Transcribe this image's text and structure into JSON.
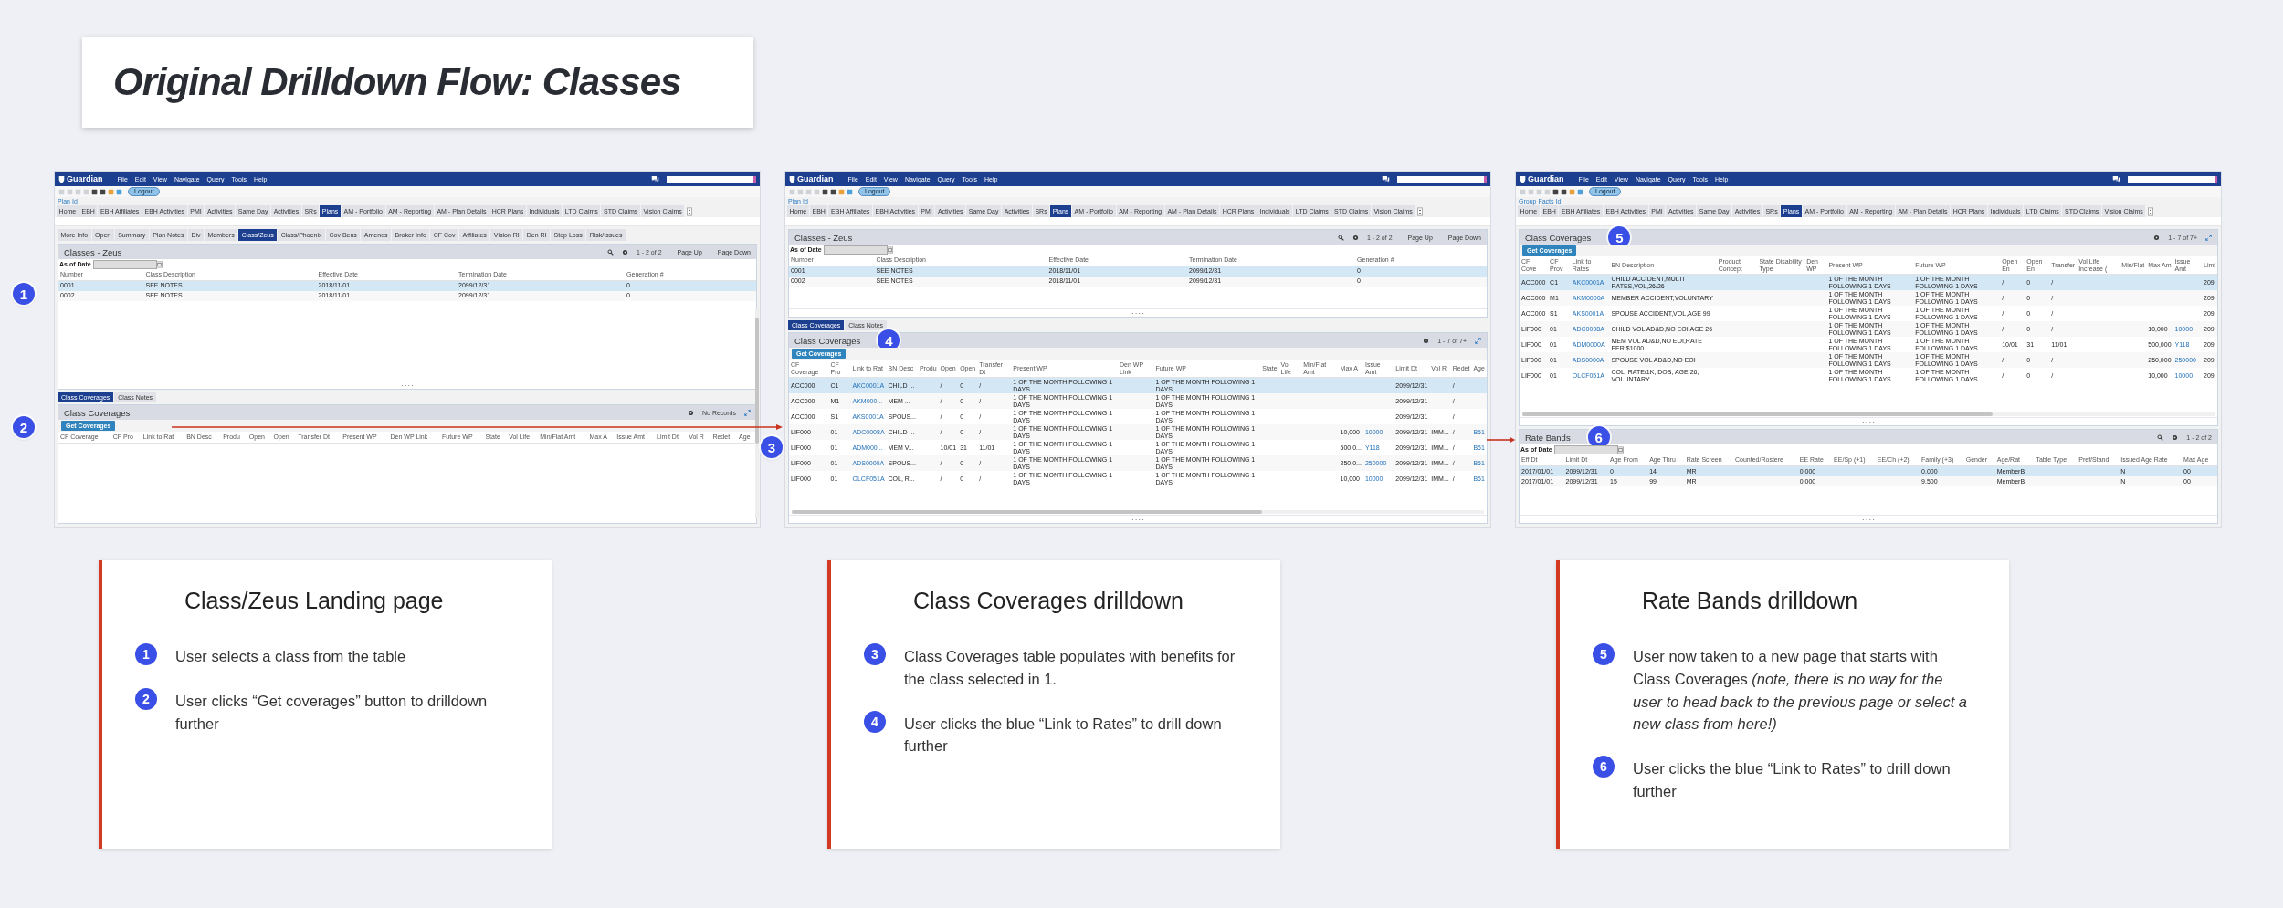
{
  "title": "Original Drilldown Flow: Classes",
  "screens": [
    {
      "app_bar": {
        "logo": "Guardian",
        "menu": [
          "File",
          "Edit",
          "View",
          "Navigate",
          "Query",
          "Tools",
          "Help"
        ]
      },
      "logout": "Logout",
      "id_label": "Plan Id",
      "vertical_scroll": true,
      "badges": [
        "1",
        "2"
      ],
      "main_tabs": [
        {
          "label": "Home",
          "selected": false
        },
        {
          "label": "EBH",
          "selected": false
        },
        {
          "label": "EBH Affiliates",
          "selected": false
        },
        {
          "label": "EBH Activities",
          "selected": false
        },
        {
          "label": "PMI",
          "selected": false
        },
        {
          "label": "Activities",
          "selected": false
        },
        {
          "label": "Same Day",
          "selected": false
        },
        {
          "label": "Activities",
          "selected": false
        },
        {
          "label": "SRs",
          "selected": false
        },
        {
          "label": "Plans",
          "selected": true
        },
        {
          "label": "AM - Portfolio",
          "selected": false
        },
        {
          "label": "AM - Reporting",
          "selected": false
        },
        {
          "label": "AM - Plan Details",
          "selected": false
        },
        {
          "label": "HCR Plans",
          "selected": false
        },
        {
          "label": "Individuals",
          "selected": false
        },
        {
          "label": "LTD Claims",
          "selected": false
        },
        {
          "label": "STD Claims",
          "selected": false
        },
        {
          "label": "Vision Claims",
          "selected": false
        }
      ],
      "sub_tabs": [
        {
          "label": "More Info",
          "selected": false
        },
        {
          "label": "Open",
          "selected": false
        },
        {
          "label": "Summary",
          "selected": false
        },
        {
          "label": "Plan Notes",
          "selected": false
        },
        {
          "label": "Div",
          "selected": false
        },
        {
          "label": "Members",
          "selected": false
        },
        {
          "label": "Class/Zeus",
          "selected": true
        },
        {
          "label": "Class/Phoenix",
          "selected": false
        },
        {
          "label": "Cov Bens",
          "selected": false
        },
        {
          "label": "Amends",
          "selected": false
        },
        {
          "label": "Broker Info",
          "selected": false
        },
        {
          "label": "CF Cov",
          "selected": false
        },
        {
          "label": "Affiliates",
          "selected": false
        },
        {
          "label": "Vision RI",
          "selected": false
        },
        {
          "label": "Den RI",
          "selected": false
        },
        {
          "label": "Stop Loss",
          "selected": false
        },
        {
          "label": "Risk/Issues",
          "selected": false
        }
      ],
      "panels": [
        {
          "title": "Classes - Zeus",
          "grip": true,
          "as_of_date": "As of Date",
          "tools": [
            {
              "kind": "search"
            },
            {
              "kind": "gear"
            },
            {
              "kind": "pager",
              "text": "1 - 2 of 2"
            },
            {
              "kind": "link",
              "text": "Page Up"
            },
            {
              "kind": "link",
              "text": "Page Down"
            }
          ],
          "columns": [
            "Number",
            "Class Description",
            "Effective Date",
            "Termination Date",
            "Generation #"
          ],
          "rows": [
            {
              "selected": true,
              "cells": [
                "0001",
                "SEE NOTES",
                "2018/11/01",
                "2099/12/31",
                "0"
              ]
            },
            {
              "selected": false,
              "cells": [
                "0002",
                "SEE NOTES",
                "2018/11/01",
                "2099/12/31",
                "0"
              ]
            }
          ]
        },
        {
          "tabs": [
            {
              "label": "Class Coverages",
              "selected": true
            },
            {
              "label": "Class Notes",
              "selected": false
            }
          ],
          "title": "Class Coverages",
          "button": "Get Coverages",
          "tools": [
            {
              "kind": "gear"
            },
            {
              "kind": "pager",
              "text": "No Records"
            },
            {
              "kind": "expand"
            }
          ],
          "columns": [
            "CF Coverage",
            "CF Pro",
            "Link to Rat",
            "BN Desc",
            "Produ",
            "Open",
            "Open",
            "Transfer Dt",
            "Present WP",
            "Den WP Link",
            "Future WP",
            "State",
            "Vol Life",
            "Min/Flat Amt",
            "Max A",
            "Issue Amt",
            "Limit Dt",
            "Vol R",
            "Redet",
            "Age"
          ]
        }
      ]
    },
    {
      "app_bar": {
        "logo": "Guardian",
        "menu": [
          "File",
          "Edit",
          "View",
          "Navigate",
          "Query",
          "Tools",
          "Help"
        ]
      },
      "logout": "Logout",
      "id_label": "Plan Id",
      "badges": [
        "3"
      ],
      "main_tabs": [
        {
          "label": "Home",
          "selected": false
        },
        {
          "label": "EBH",
          "selected": false
        },
        {
          "label": "EBH Affiliates",
          "selected": false
        },
        {
          "label": "EBH Activities",
          "selected": false
        },
        {
          "label": "PMI",
          "selected": false
        },
        {
          "label": "Activities",
          "selected": false
        },
        {
          "label": "Same Day",
          "selected": false
        },
        {
          "label": "Activities",
          "selected": false
        },
        {
          "label": "SRs",
          "selected": false
        },
        {
          "label": "Plans",
          "selected": true
        },
        {
          "label": "AM - Portfolio",
          "selected": false
        },
        {
          "label": "AM - Reporting",
          "selected": false
        },
        {
          "label": "AM - Plan Details",
          "selected": false
        },
        {
          "label": "HCR Plans",
          "selected": false
        },
        {
          "label": "Individuals",
          "selected": false
        },
        {
          "label": "LTD Claims",
          "selected": false
        },
        {
          "label": "STD Claims",
          "selected": false
        },
        {
          "label": "Vision Claims",
          "selected": false
        }
      ],
      "panels": [
        {
          "title": "Classes - Zeus",
          "grip": true,
          "as_of_date": "As of Date",
          "tools": [
            {
              "kind": "search"
            },
            {
              "kind": "gear"
            },
            {
              "kind": "pager",
              "text": "1 - 2 of 2"
            },
            {
              "kind": "link",
              "text": "Page Up"
            },
            {
              "kind": "link",
              "text": "Page Down"
            }
          ],
          "columns": [
            "Number",
            "Class Description",
            "Effective Date",
            "Termination Date",
            "Generation #"
          ],
          "rows": [
            {
              "selected": true,
              "cells": [
                "0001",
                "SEE NOTES",
                "2018/11/01",
                "2099/12/31",
                "0"
              ]
            },
            {
              "selected": false,
              "cells": [
                "0002",
                "SEE NOTES",
                "2018/11/01",
                "2099/12/31",
                "0"
              ]
            }
          ]
        },
        {
          "tabs": [
            {
              "label": "Class Coverages",
              "selected": true
            },
            {
              "label": "Class Notes",
              "selected": false
            }
          ],
          "title": "Class Coverages",
          "badge": "4",
          "button": "Get Coverages",
          "grip": true,
          "horizontal_scroll": true,
          "tools": [
            {
              "kind": "gear"
            },
            {
              "kind": "pager",
              "text": "1 - 7 of 7+"
            },
            {
              "kind": "expand"
            }
          ],
          "columns": [
            "CF Coverage",
            "CF Pro",
            "Link to Rat",
            "BN Desc",
            "Produ",
            "Open",
            "Open",
            "Transfer Dt",
            "Present WP",
            "Den WP Link",
            "Future WP",
            "State",
            "Vol Life",
            "Min/Flat Amt",
            "Max A",
            "Issue Amt",
            "Limit Dt",
            "Vol R",
            "Redet",
            "Age"
          ],
          "rows": [
            {
              "selected": true,
              "cells": [
                "ACC000",
                "C1",
                {
                  "kind": "link",
                  "text": "AKC0001A"
                },
                "CHILD ...",
                null,
                "/",
                "0",
                "/",
                "1 OF THE MONTH FOLLOWING 1 DAYS",
                null,
                "1 OF THE MONTH FOLLOWING 1 DAYS",
                null,
                null,
                null,
                null,
                null,
                "2099/12/31",
                null,
                "/",
                null
              ]
            },
            {
              "selected": false,
              "cells": [
                "ACC000",
                "M1",
                {
                  "kind": "link",
                  "text": "AKM000..."
                },
                "MEM ...",
                null,
                "/",
                "0",
                "/",
                "1 OF THE MONTH FOLLOWING 1 DAYS",
                null,
                "1 OF THE MONTH FOLLOWING 1 DAYS",
                null,
                null,
                null,
                null,
                null,
                "2099/12/31",
                null,
                "/",
                null
              ]
            },
            {
              "selected": false,
              "cells": [
                "ACC000",
                "S1",
                {
                  "kind": "link",
                  "text": "AKS0001A"
                },
                "SPOUS...",
                null,
                "/",
                "0",
                "/",
                "1 OF THE MONTH FOLLOWING 1 DAYS",
                null,
                "1 OF THE MONTH FOLLOWING 1 DAYS",
                null,
                null,
                null,
                null,
                null,
                "2099/12/31",
                null,
                "/",
                null
              ]
            },
            {
              "selected": false,
              "cells": [
                "LIF000",
                "01",
                {
                  "kind": "link",
                  "text": "ADC0008A"
                },
                "CHILD ...",
                null,
                "/",
                "0",
                "/",
                "1 OF THE MONTH FOLLOWING 1 DAYS",
                null,
                "1 OF THE MONTH FOLLOWING 1 DAYS",
                null,
                null,
                null,
                "10,000",
                {
                  "kind": "link",
                  "text": "10000"
                },
                "2099/12/31",
                "IMM...",
                "/",
                {
                  "kind": "link",
                  "text": "B51"
                }
              ]
            },
            {
              "selected": false,
              "cells": [
                "LIF000",
                "01",
                {
                  "kind": "link",
                  "text": "ADM000..."
                },
                "MEM V...",
                null,
                "10/01",
                "31",
                "11/01",
                "1 OF THE MONTH FOLLOWING 1 DAYS",
                null,
                "1 OF THE MONTH FOLLOWING 1 DAYS",
                null,
                null,
                null,
                "500,0...",
                {
                  "kind": "link",
                  "text": "Y118"
                },
                "2099/12/31",
                "IMM...",
                "/",
                {
                  "kind": "link",
                  "text": "B51"
                }
              ]
            },
            {
              "selected": false,
              "cells": [
                "LIF000",
                "01",
                {
                  "kind": "link",
                  "text": "ADS0000A"
                },
                "SPOUS...",
                null,
                "/",
                "0",
                "/",
                "1 OF THE MONTH FOLLOWING 1 DAYS",
                null,
                "1 OF THE MONTH FOLLOWING 1 DAYS",
                null,
                null,
                null,
                "250,0...",
                {
                  "kind": "link",
                  "text": "250000"
                },
                "2099/12/31",
                "IMM...",
                "/",
                {
                  "kind": "link",
                  "text": "B51"
                }
              ]
            },
            {
              "selected": false,
              "cells": [
                "LIF000",
                "01",
                {
                  "kind": "link",
                  "text": "OLCF051A"
                },
                "COL, R...",
                null,
                "/",
                "0",
                "/",
                "1 OF THE MONTH FOLLOWING 1 DAYS",
                null,
                "1 OF THE MONTH FOLLOWING 1 DAYS",
                null,
                null,
                null,
                "10,000",
                {
                  "kind": "link",
                  "text": "10000"
                },
                "2099/12/31",
                "IMM...",
                "/",
                {
                  "kind": "link",
                  "text": "B51"
                }
              ]
            }
          ]
        }
      ]
    },
    {
      "app_bar": {
        "logo": "Guardian",
        "menu": [
          "File",
          "Edit",
          "View",
          "Navigate",
          "Query",
          "Tools",
          "Help"
        ]
      },
      "logout": "Logout",
      "id_label": "Group Facts Id",
      "main_tabs": [
        {
          "label": "Home",
          "selected": false
        },
        {
          "label": "EBH",
          "selected": false
        },
        {
          "label": "EBH Affiliates",
          "selected": false
        },
        {
          "label": "EBH Activities",
          "selected": false
        },
        {
          "label": "PMI",
          "selected": false
        },
        {
          "label": "Activities",
          "selected": false
        },
        {
          "label": "Same Day",
          "selected": false
        },
        {
          "label": "Activities",
          "selected": false
        },
        {
          "label": "SRs",
          "selected": false
        },
        {
          "label": "Plans",
          "selected": true
        },
        {
          "label": "AM - Portfolio",
          "selected": false
        },
        {
          "label": "AM - Reporting",
          "selected": false
        },
        {
          "label": "AM - Plan Details",
          "selected": false
        },
        {
          "label": "HCR Plans",
          "selected": false
        },
        {
          "label": "Individuals",
          "selected": false
        },
        {
          "label": "LTD Claims",
          "selected": false
        },
        {
          "label": "STD Claims",
          "selected": false
        },
        {
          "label": "Vision Claims",
          "selected": false
        }
      ],
      "panels": [
        {
          "title": "Class Coverages",
          "badge": "5",
          "button": "Get Coverages",
          "grip": true,
          "horizontal_scroll": true,
          "tools": [
            {
              "kind": "gear"
            },
            {
              "kind": "pager",
              "text": "1 - 7 of 7+"
            },
            {
              "kind": "expand"
            }
          ],
          "columns": [
            "CF Cove",
            "CF Prov",
            "Link to Rates",
            "BN Description",
            "Product Concept",
            "State Disability Type",
            "Den WP",
            "Present WP",
            "Future WP",
            "Open En",
            "Open En",
            "Transfer",
            "Vol Life Increase (",
            "Min/Flat",
            "Max Am",
            "Issue Amt",
            "Limi"
          ],
          "rows": [
            {
              "selected": true,
              "cells": [
                "ACC000",
                "C1",
                {
                  "kind": "link",
                  "text": "AKC0001A"
                },
                "CHILD ACCIDENT,MULTI RATES,VOL,26/26",
                null,
                null,
                null,
                "1 OF THE MONTH FOLLOWING 1 DAYS",
                "1 OF THE MONTH FOLLOWING 1 DAYS",
                "/",
                "0",
                "/",
                null,
                null,
                null,
                null,
                "209"
              ]
            },
            {
              "selected": false,
              "cells": [
                "ACC000",
                "M1",
                {
                  "kind": "link",
                  "text": "AKM0000A"
                },
                "MEMBER ACCIDENT,VOLUNTARY",
                null,
                null,
                null,
                "1 OF THE MONTH FOLLOWING 1 DAYS",
                "1 OF THE MONTH FOLLOWING 1 DAYS",
                "/",
                "0",
                "/",
                null,
                null,
                null,
                null,
                "209"
              ]
            },
            {
              "selected": false,
              "cells": [
                "ACC000",
                "S1",
                {
                  "kind": "link",
                  "text": "AKS0001A"
                },
                "SPOUSE ACCIDENT,VOL,AGE 99",
                null,
                null,
                null,
                "1 OF THE MONTH FOLLOWING 1 DAYS",
                "1 OF THE MONTH FOLLOWING 1 DAYS",
                "/",
                "0",
                "/",
                null,
                null,
                null,
                null,
                "209"
              ]
            },
            {
              "selected": false,
              "cells": [
                "LIF000",
                "01",
                {
                  "kind": "link",
                  "text": "ADC0008A"
                },
                "CHILD VOL AD&D,NO EOI,AGE 26",
                null,
                null,
                null,
                "1 OF THE MONTH FOLLOWING 1 DAYS",
                "1 OF THE MONTH FOLLOWING 1 DAYS",
                "/",
                "0",
                "/",
                null,
                null,
                "10,000",
                {
                  "kind": "link",
                  "text": "10000"
                },
                "209"
              ]
            },
            {
              "selected": false,
              "cells": [
                "LIF000",
                "01",
                {
                  "kind": "link",
                  "text": "ADM0000A"
                },
                "MEM VOL AD&D,NO EOI,RATE PER $1000",
                null,
                null,
                null,
                "1 OF THE MONTH FOLLOWING 1 DAYS",
                "1 OF THE MONTH FOLLOWING 1 DAYS",
                "10/01",
                "31",
                "11/01",
                null,
                null,
                "500,000",
                {
                  "kind": "link",
                  "text": "Y118"
                },
                "209"
              ]
            },
            {
              "selected": false,
              "cells": [
                "LIF000",
                "01",
                {
                  "kind": "link",
                  "text": "ADS0000A"
                },
                "SPOUSE VOL AD&D,NO EOI",
                null,
                null,
                null,
                "1 OF THE MONTH FOLLOWING 1 DAYS",
                "1 OF THE MONTH FOLLOWING 1 DAYS",
                "/",
                "0",
                "/",
                null,
                null,
                "250,000",
                {
                  "kind": "link",
                  "text": "250000"
                },
                "209"
              ]
            },
            {
              "selected": false,
              "cells": [
                "LIF000",
                "01",
                {
                  "kind": "link",
                  "text": "OLCF051A"
                },
                "COL, RATE/1K, DOB, AGE 26, VOLUNTARY",
                null,
                null,
                null,
                "1 OF THE MONTH FOLLOWING 1 DAYS",
                "1 OF THE MONTH FOLLOWING 1 DAYS",
                "/",
                "0",
                "/",
                null,
                null,
                "10,000",
                {
                  "kind": "link",
                  "text": "10000"
                },
                "209"
              ]
            }
          ]
        },
        {
          "title": "Rate Bands",
          "badge": "6",
          "grip": true,
          "as_of_date": "As of Date",
          "tools": [
            {
              "kind": "search"
            },
            {
              "kind": "gear"
            },
            {
              "kind": "pager",
              "text": "1 - 2 of 2"
            }
          ],
          "columns": [
            "Eff Dt",
            "Limit Dt",
            "Age From",
            "Age Thru",
            "Rate Screen",
            "Counted/Rostere",
            "EE Rate",
            "EE/Sp (+1)",
            "EE/Ch (+2)",
            "Family (+3)",
            "Gender",
            "Age/Rat",
            "Table Type",
            "Pref/Stand",
            "Issued Age Rate",
            "Max Age"
          ],
          "rows": [
            {
              "selected": true,
              "cells": [
                "2017/01/01",
                "2099/12/31",
                "0",
                "14",
                "MR",
                null,
                "0.000",
                null,
                null,
                "0.000",
                null,
                "MemberB",
                null,
                null,
                "N",
                "00"
              ]
            },
            {
              "selected": false,
              "cells": [
                "2017/01/01",
                "2099/12/31",
                "15",
                "99",
                "MR",
                null,
                "0.000",
                null,
                null,
                "9.500",
                null,
                "MemberB",
                null,
                null,
                "N",
                "00"
              ]
            }
          ]
        }
      ]
    }
  ],
  "cards": [
    {
      "title": "Class/Zeus Landing page",
      "steps": [
        {
          "number": "1",
          "text": "User selects a class from the table"
        },
        {
          "number": "2",
          "text": "User clicks “Get coverages” button to drilldown further"
        }
      ]
    },
    {
      "title": "Class Coverages drilldown",
      "steps": [
        {
          "number": "3",
          "text": "Class Coverages table populates with benefits for the class selected in 1."
        },
        {
          "number": "4",
          "text": "User clicks the blue “Link to Rates” to drill down further"
        }
      ]
    },
    {
      "title": "Rate Bands drilldown",
      "steps": [
        {
          "number": "5",
          "text": "User now taken to a new page that starts with Class Coverages *(note, there is no way for the user to head back to the previous page or select a new class from here!)*"
        },
        {
          "number": "6",
          "text": "User clicks the blue “Link to Rates” to drill down further"
        }
      ]
    }
  ]
}
